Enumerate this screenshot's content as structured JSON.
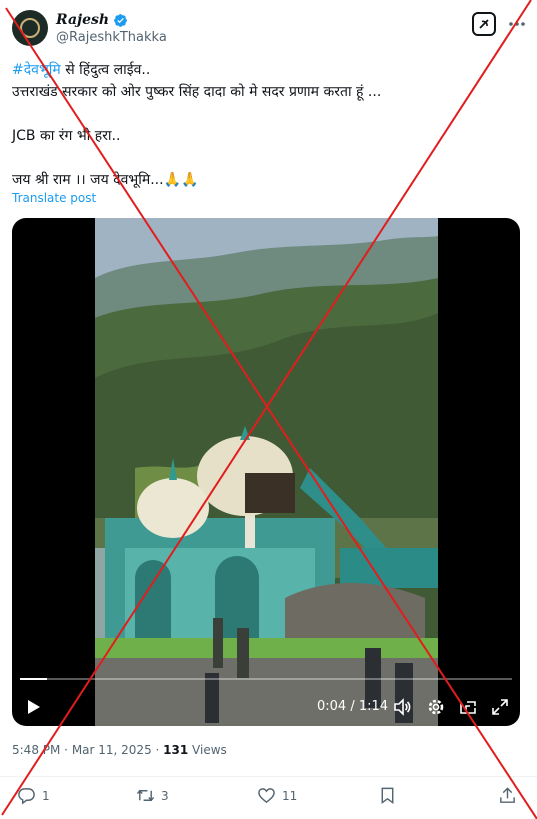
{
  "author": {
    "display_name": "Rajesh",
    "handle": "@RajeshkThakka"
  },
  "post": {
    "hashtag": "#देवभूमि",
    "line1_rest": " से हिंदुत्व लाईव..",
    "line2": " उत्तराखंड सरकार को ओर पुष्कर सिंह दादा को मे सदर  प्रणाम करता हूं ...",
    "line3": "JCB का रंग भी हरा..",
    "line4": "जय श्री राम ।। जय देवभूमि...🙏🙏",
    "translate_label": "Translate post"
  },
  "video": {
    "time_label": "0:04 / 1:14",
    "progress": 0.054
  },
  "meta": {
    "time": "5:48 PM",
    "sep1": " · ",
    "date": "Mar 11, 2025",
    "sep2": " · ",
    "views_count": "131",
    "views_label": " Views"
  },
  "actions": {
    "replies": "1",
    "reposts": "3",
    "likes": "11"
  },
  "icons": [
    "verified-badge-icon",
    "grok-icon",
    "more-icon",
    "play-icon",
    "volume-icon",
    "settings-icon",
    "pip-icon",
    "fullscreen-icon",
    "reply-icon",
    "repost-icon",
    "like-icon",
    "bookmark-icon",
    "share-icon"
  ],
  "colors": {
    "accent": "#1d9bf0",
    "secondary_text": "#536471",
    "strike": "#e11d1d"
  }
}
